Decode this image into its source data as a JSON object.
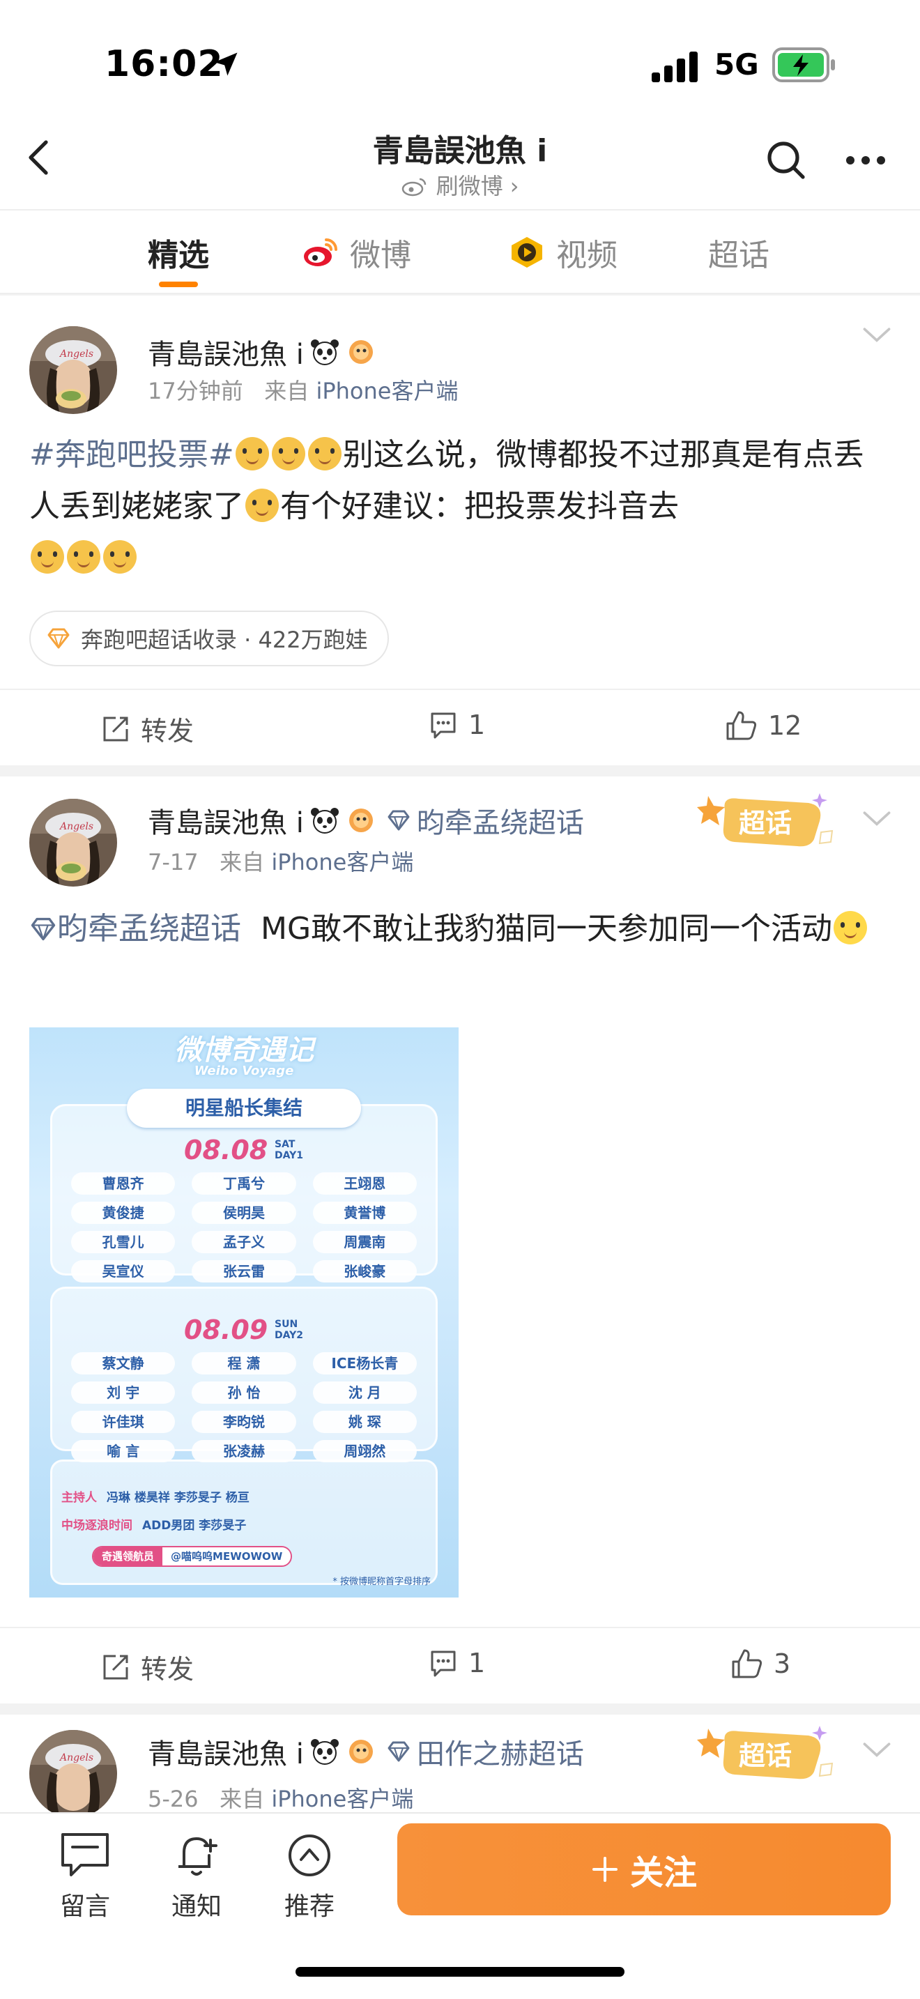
{
  "status": {
    "time": "16:02",
    "network": "5G"
  },
  "nav": {
    "title": "青島誤池魚 i",
    "subtitle": "刷微博 ›"
  },
  "tabs": [
    {
      "label": "精选",
      "active": true
    },
    {
      "label": "微博",
      "active": false
    },
    {
      "label": "视频",
      "active": false
    },
    {
      "label": "超话",
      "active": false
    }
  ],
  "posts": [
    {
      "username": "青島誤池魚 i",
      "time": "17分钟前",
      "source_prefix": "来自",
      "source": "iPhone客户端",
      "topic": "#奔跑吧投票#",
      "text_1": "别这么说，微博都投不过那真是有点丢人丢到姥姥家了",
      "text_2": "有个好建议：把投票发抖音去",
      "chip": "奔跑吧超话收录 · 422万跑娃",
      "repost_label": "转发",
      "comments": "1",
      "likes": "12"
    },
    {
      "username": "青島誤池魚 i",
      "supertopic": "昀牵孟绕超话",
      "badge": "超话",
      "time": "7-17",
      "source_prefix": "来自",
      "source": "iPhone客户端",
      "topic": "昀牵孟绕超话",
      "text": "MG敢不敢让我豹猫同一天参加同一个活动",
      "repost_label": "转发",
      "comments": "1",
      "likes": "3",
      "poster": {
        "header": "微博奇遇记",
        "header_sub": "Weibo Voyage",
        "ribbon": "明星船长集结",
        "day1": {
          "date": "08.08",
          "weekday": "SAT",
          "day": "DAY1",
          "names": [
            "曹恩齐",
            "丁禹兮",
            "王翊恩",
            "黄俊捷",
            "侯明昊",
            "黄誉博",
            "孔雪儿",
            "孟子义",
            "周震南",
            "吴宣仪",
            "张云雷",
            "张峻豪"
          ]
        },
        "day2": {
          "date": "08.09",
          "weekday": "SUN",
          "day": "DAY2",
          "names": [
            "蔡文静",
            "程 潇",
            "ICE杨长青",
            "刘 宇",
            "孙 怡",
            "沈 月",
            "许佳琪",
            "李昀锐",
            "姚 琛",
            "喻 言",
            "张凌赫",
            "周翊然"
          ]
        },
        "host_label": "主持人",
        "hosts": "冯琳  楼昊祥  李莎旻子  杨亘",
        "mid_label": "中场逐浪时间",
        "mid": "ADD男团  李莎旻子",
        "crew_label": "奇遇领航员",
        "crew": "@喵呜呜MEWOWOW",
        "note": "* 按微博昵称首字母排序"
      }
    },
    {
      "username": "青島誤池魚 i",
      "supertopic": "田作之赫超话",
      "badge": "超话",
      "time": "5-26",
      "source_prefix": "来自",
      "source": "iPhone客户端"
    }
  ],
  "bottom": {
    "comment": "留言",
    "notify": "通知",
    "recommend": "推荐",
    "follow": "关注"
  },
  "colors": {
    "accent": "#ff8200",
    "link": "#5d6f8e",
    "follow": "#f68a2f"
  }
}
